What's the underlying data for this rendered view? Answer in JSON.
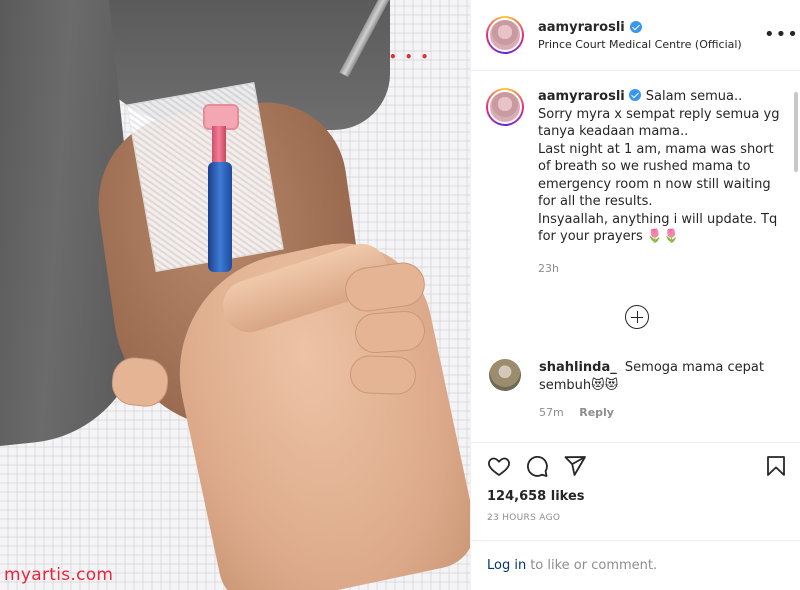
{
  "watermark": "myartis.com",
  "header": {
    "username": "aamyrarosli",
    "location": "Prince Court Medical Centre (Official)"
  },
  "caption": {
    "username": "aamyrarosli",
    "lines": [
      "Salam semua..",
      "Sorry myra x sempat reply semua yg tanya keadaan mama..",
      "Last night at 1 am, mama was short of breath so we rushed mama to emergency room n now still waiting for all the results.",
      "Insyaallah, anything i will update. Tq for your prayers"
    ],
    "emoji": "🌷🌷",
    "time": "23h"
  },
  "comment": {
    "username": "shahlinda_",
    "text": "Semoga mama cepat sembuh",
    "emoji": "😻😻",
    "time": "57m",
    "reply_label": "Reply"
  },
  "icons": [
    "verified-badge",
    "more-options-icon",
    "load-more-icon",
    "heart-icon",
    "comment-icon",
    "share-icon",
    "bookmark-icon"
  ],
  "likes": "124,658 likes",
  "posted": "23 HOURS AGO",
  "footer": {
    "login_label": "Log in",
    "rest": "to like or comment."
  },
  "colors": {
    "link": "#00376b",
    "muted": "#8e8e8e",
    "verified": "#3897f0",
    "watermark": "#e8263a"
  }
}
